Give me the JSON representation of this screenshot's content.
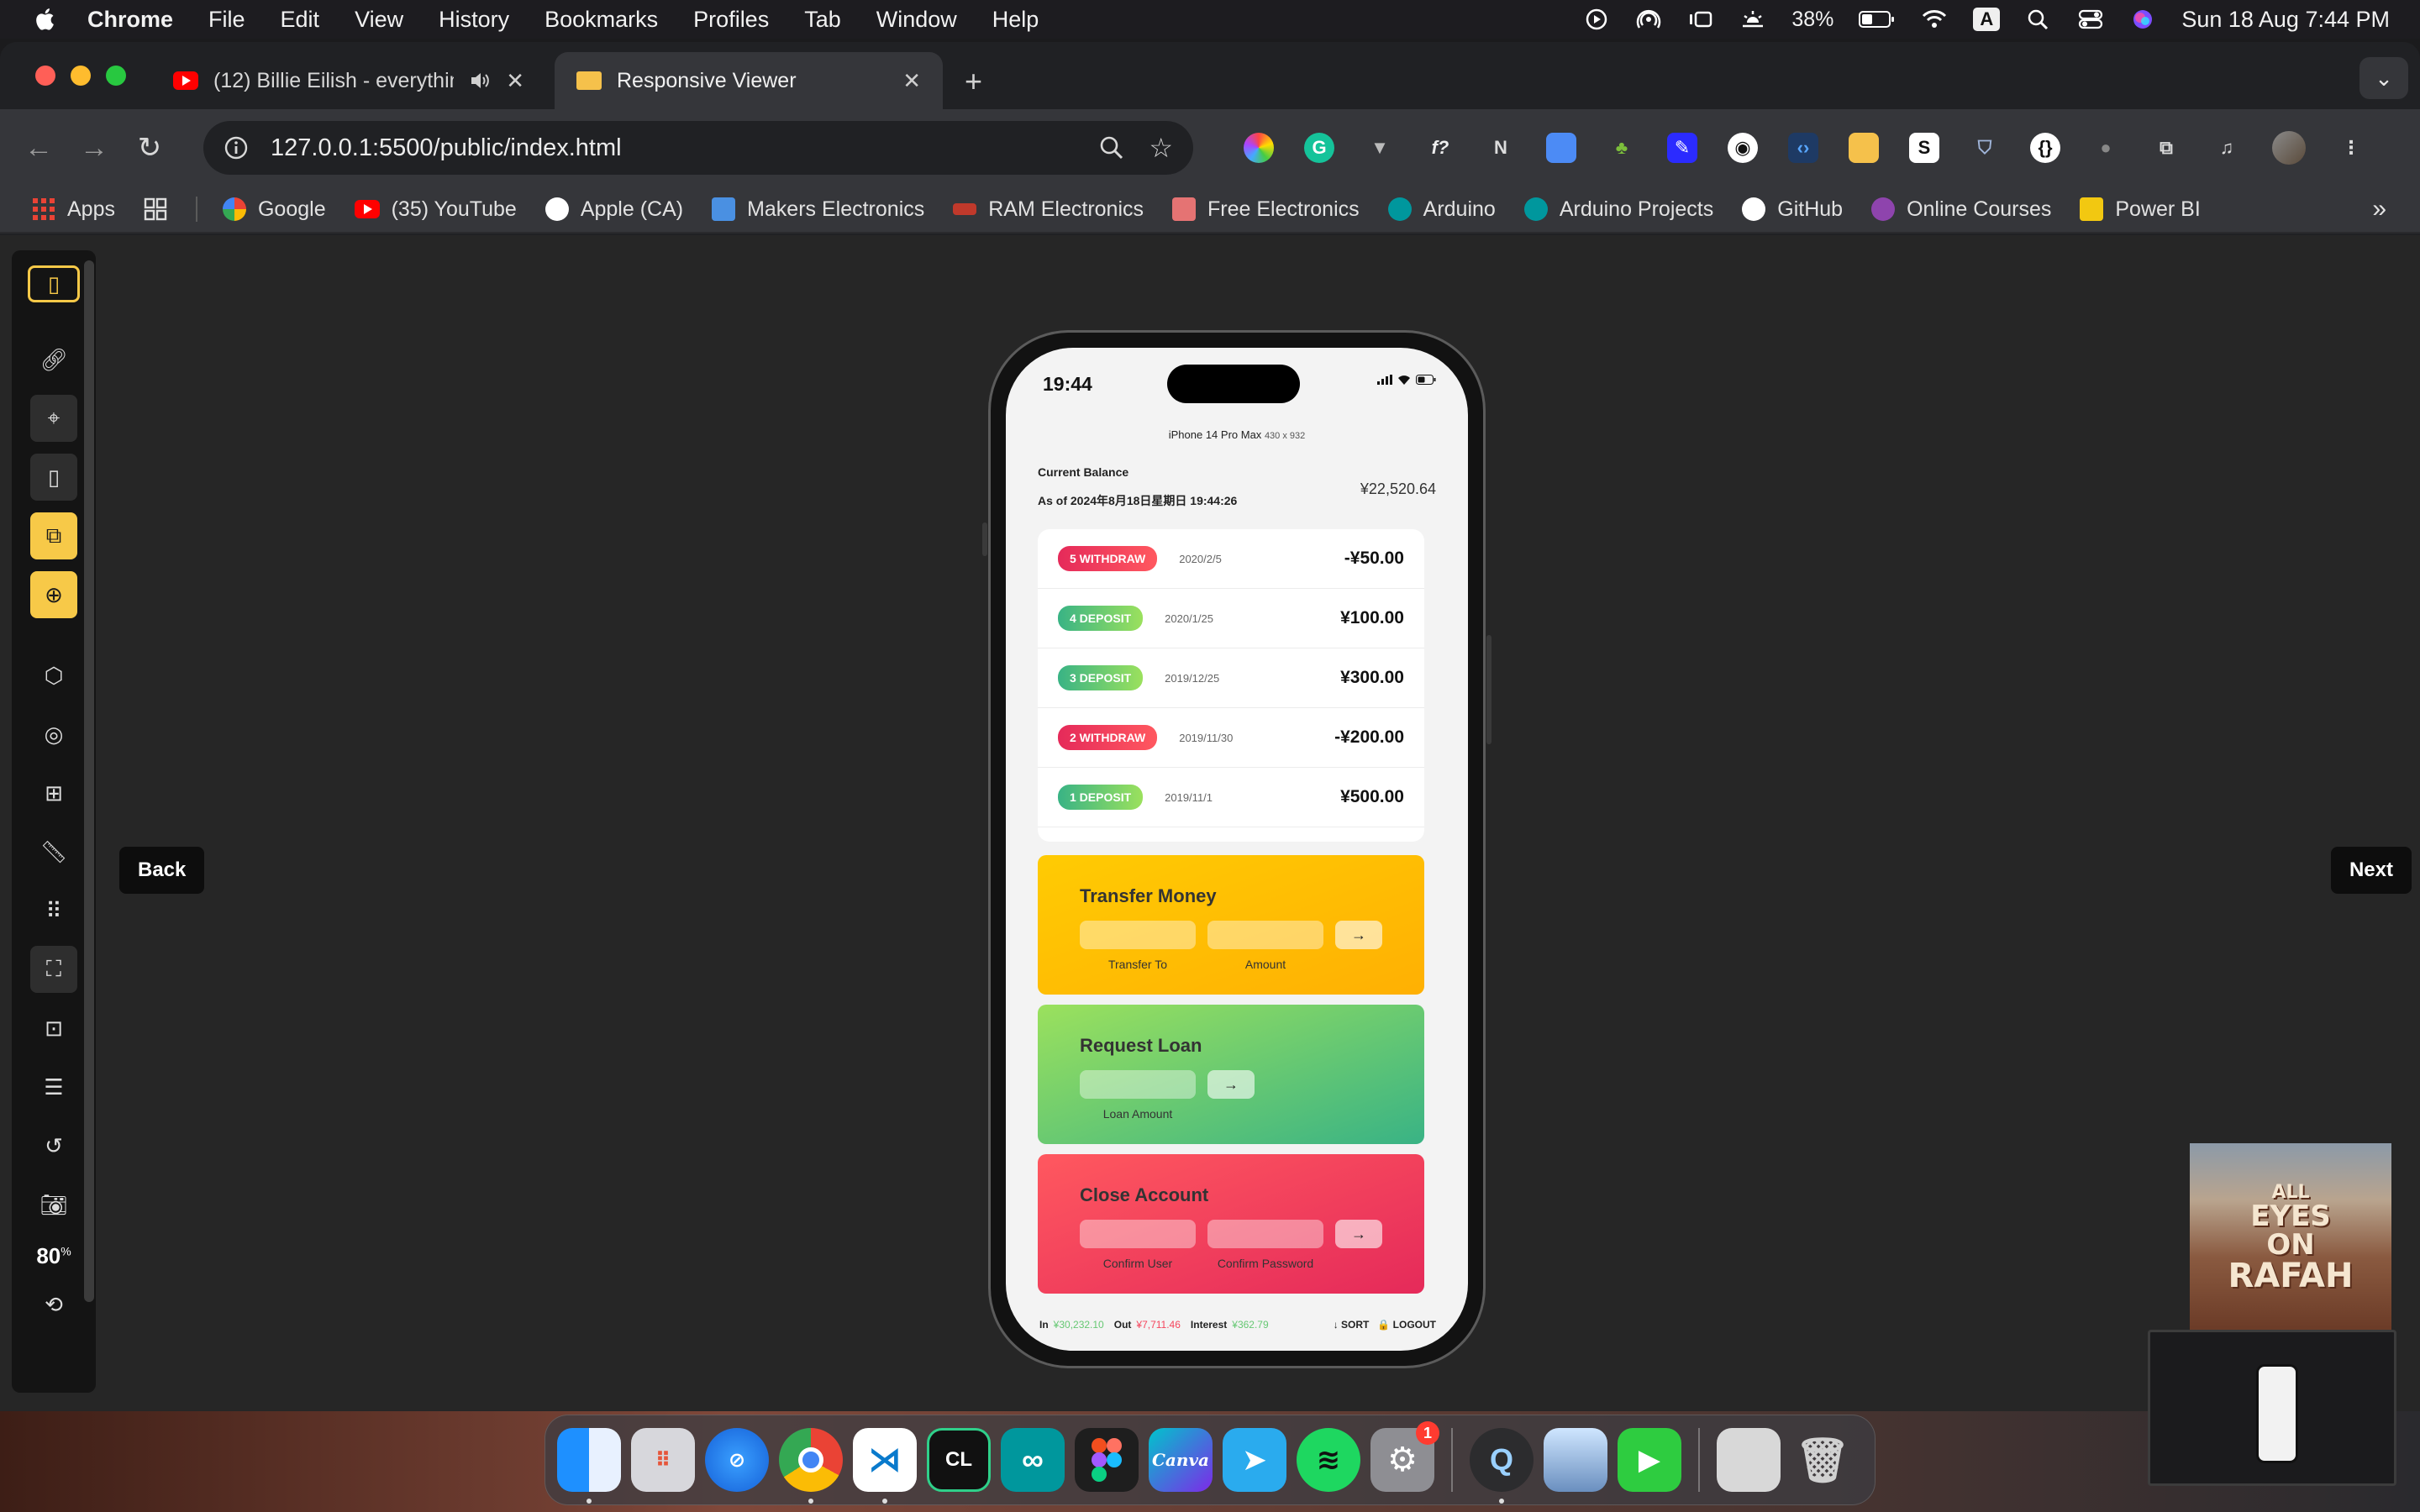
{
  "menubar": {
    "app_name": "Chrome",
    "menus": [
      "File",
      "Edit",
      "View",
      "History",
      "Bookmarks",
      "Profiles",
      "Tab",
      "Window",
      "Help"
    ],
    "battery": "38%",
    "keyboard": "A",
    "datetime": "Sun 18 Aug  7:44 PM"
  },
  "browser": {
    "tabs": [
      {
        "title": "(12) Billie Eilish - everything i w",
        "favicon": "youtube-icon"
      },
      {
        "title": "Responsive Viewer",
        "favicon": "responsive-viewer-icon"
      }
    ],
    "url": "127.0.0.1:5500/public/index.html",
    "bookmarks": [
      {
        "label": "Apps",
        "color": "#ea4335"
      },
      {
        "label": "Google",
        "color": "#4285f4"
      },
      {
        "label": "(35) YouTube",
        "color": "#ff0000"
      },
      {
        "label": "Apple (CA)",
        "color": "#ffffff"
      },
      {
        "label": "Makers Electronics",
        "color": "#4a90e2"
      },
      {
        "label": "RAM Electronics",
        "color": "#c0392b"
      },
      {
        "label": "Free Electronics",
        "color": "#e57373"
      },
      {
        "label": "Arduino",
        "color": "#00979d"
      },
      {
        "label": "Arduino Projects",
        "color": "#00979d"
      },
      {
        "label": "GitHub",
        "color": "#ffffff"
      },
      {
        "label": "Online Courses",
        "color": "#8e44ad"
      },
      {
        "label": "Power BI",
        "color": "#f2c811"
      }
    ]
  },
  "viewer": {
    "back_label": "Back",
    "next_label": "Next",
    "zoom": "80",
    "zoom_unit": "%"
  },
  "phone": {
    "time": "19:44",
    "device_name": "iPhone 14 Pro Max",
    "device_size": "430 x 932"
  },
  "bank": {
    "balance_label": "Current Balance",
    "balance_date": "As of 2024年8月18日星期日 19:44:26",
    "balance_value": "¥22,520.64",
    "movements": [
      {
        "type": "5 withdraw",
        "kind": "withdraw",
        "date": "2020/2/5",
        "amount": "-¥50.00"
      },
      {
        "type": "4 deposit",
        "kind": "deposit",
        "date": "2020/1/25",
        "amount": "¥100.00"
      },
      {
        "type": "3 deposit",
        "kind": "deposit",
        "date": "2019/12/25",
        "amount": "¥300.00"
      },
      {
        "type": "2 withdraw",
        "kind": "withdraw",
        "date": "2019/11/30",
        "amount": "-¥200.00"
      },
      {
        "type": "1 deposit",
        "kind": "deposit",
        "date": "2019/11/1",
        "amount": "¥500.00"
      }
    ],
    "transfer": {
      "title": "Transfer Money",
      "to_label": "Transfer To",
      "amount_label": "Amount",
      "button": "→"
    },
    "loan": {
      "title": "Request Loan",
      "amount_label": "Loan Amount",
      "button": "→"
    },
    "close": {
      "title": "Close Account",
      "user_label": "Confirm User",
      "pin_label": "Confirm Password",
      "button": "→"
    },
    "summary": {
      "in_label": "In",
      "in_value": "¥30,232.10",
      "out_label": "Out",
      "out_value": "¥7,711.46",
      "interest_label": "Interest",
      "interest_value": "¥362.79",
      "sort_label": "↓ SORT",
      "logout_label": "🔒 LOGOUT"
    }
  },
  "wallpaper_thumb": {
    "text_line1": "ALL",
    "text_line2": "EYES",
    "text_line3": "ON",
    "text_line4": "RAFAH"
  },
  "dock": {
    "settings_badge": "1",
    "canva_label": "Canva",
    "clion_label": "CL"
  }
}
